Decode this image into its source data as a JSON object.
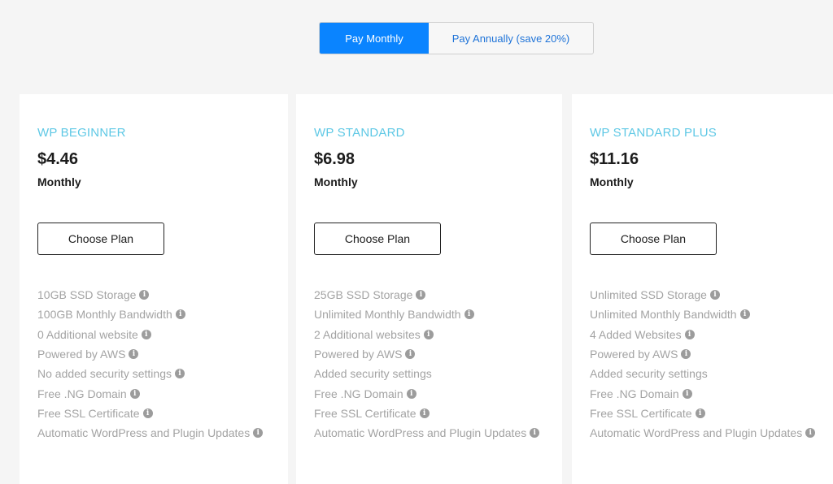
{
  "billing_toggle": {
    "monthly_label": "Pay Monthly",
    "annual_label": "Pay Annually (save 20%)",
    "selected": "monthly"
  },
  "plans": [
    {
      "name": "WP BEGINNER",
      "price": "$4.46",
      "period": "Monthly",
      "button_label": "Choose Plan",
      "features": [
        {
          "text": "10GB SSD Storage",
          "info_icon": true
        },
        {
          "text": "100GB Monthly Bandwidth",
          "info_icon": true
        },
        {
          "text": "0 Additional website",
          "info_icon": true
        },
        {
          "text": "Powered by AWS",
          "info_icon": true
        },
        {
          "text": "No added security settings",
          "info_icon": true
        },
        {
          "text": "Free .NG Domain",
          "info_icon": true
        },
        {
          "text": "Free SSL Certificate",
          "info_icon": true
        },
        {
          "text": "Automatic WordPress and Plugin Updates",
          "info_icon": true
        }
      ]
    },
    {
      "name": "WP STANDARD",
      "price": "$6.98",
      "period": "Monthly",
      "button_label": "Choose Plan",
      "features": [
        {
          "text": "25GB SSD Storage",
          "info_icon": true
        },
        {
          "text": "Unlimited Monthly Bandwidth",
          "info_icon": true
        },
        {
          "text": "2 Additional websites",
          "info_icon": true
        },
        {
          "text": "Powered by AWS",
          "info_icon": true
        },
        {
          "text": "Added security settings",
          "info_icon": false
        },
        {
          "text": "Free .NG Domain",
          "info_icon": true
        },
        {
          "text": "Free SSL Certificate",
          "info_icon": true
        },
        {
          "text": "Automatic WordPress and Plugin Updates",
          "info_icon": true
        }
      ]
    },
    {
      "name": "WP STANDARD PLUS",
      "price": "$11.16",
      "period": "Monthly",
      "button_label": "Choose Plan",
      "features": [
        {
          "text": "Unlimited SSD Storage",
          "info_icon": true
        },
        {
          "text": "Unlimited Monthly Bandwidth",
          "info_icon": true
        },
        {
          "text": "4 Added Websites",
          "info_icon": true
        },
        {
          "text": "Powered by AWS",
          "info_icon": true
        },
        {
          "text": "Added security settings",
          "info_icon": false
        },
        {
          "text": "Free .NG Domain",
          "info_icon": true
        },
        {
          "text": "Free SSL Certificate",
          "info_icon": true
        },
        {
          "text": "Automatic WordPress and Plugin Updates",
          "info_icon": true
        }
      ]
    }
  ],
  "colors": {
    "accent": "#0a84ff",
    "plan_name": "#5ec8e5",
    "feature_text": "#a3a3a3",
    "background": "#f5f5f5"
  },
  "icons": {
    "info": "info-icon"
  }
}
